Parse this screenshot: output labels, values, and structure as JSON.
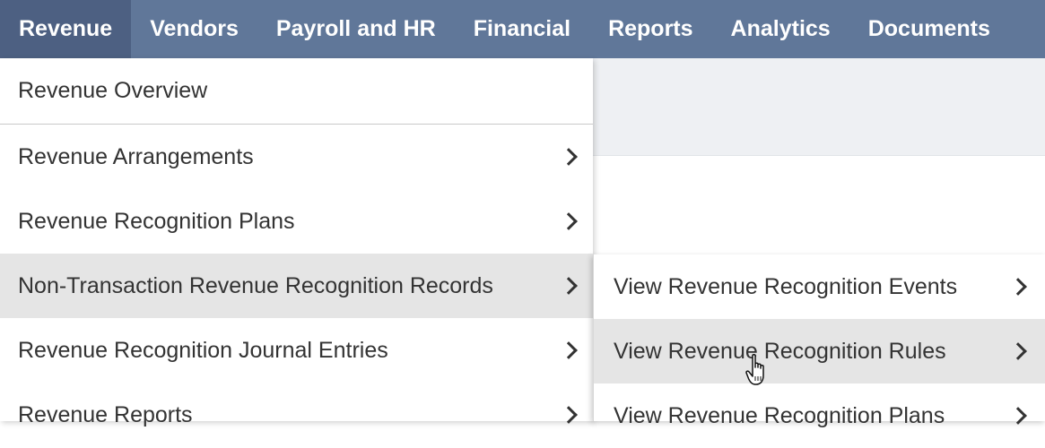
{
  "topnav": {
    "tabs": [
      {
        "label": "Revenue",
        "active": true
      },
      {
        "label": "Vendors"
      },
      {
        "label": "Payroll and HR"
      },
      {
        "label": "Financial"
      },
      {
        "label": "Reports"
      },
      {
        "label": "Analytics"
      },
      {
        "label": "Documents"
      }
    ]
  },
  "menu": {
    "items": [
      {
        "label": "Revenue Overview"
      },
      {
        "label": "Revenue Arrangements"
      },
      {
        "label": "Revenue Recognition Plans"
      },
      {
        "label": "Non-Transaction Revenue Recognition Records",
        "hovered": true
      },
      {
        "label": "Revenue Recognition Journal Entries"
      },
      {
        "label": "Revenue Reports"
      }
    ]
  },
  "submenu": {
    "items": [
      {
        "label": "View Revenue Recognition Events"
      },
      {
        "label": "View Revenue Recognition Rules",
        "hovered": true
      },
      {
        "label": "View Revenue Recognition Plans"
      }
    ]
  },
  "colors": {
    "nav_bg": "#607799",
    "nav_active": "#4d6082",
    "hover_bg": "#e5e5e5"
  },
  "icons": {
    "submenu_arrow": "chevron-right-icon",
    "pointer": "hand-pointer-icon"
  }
}
